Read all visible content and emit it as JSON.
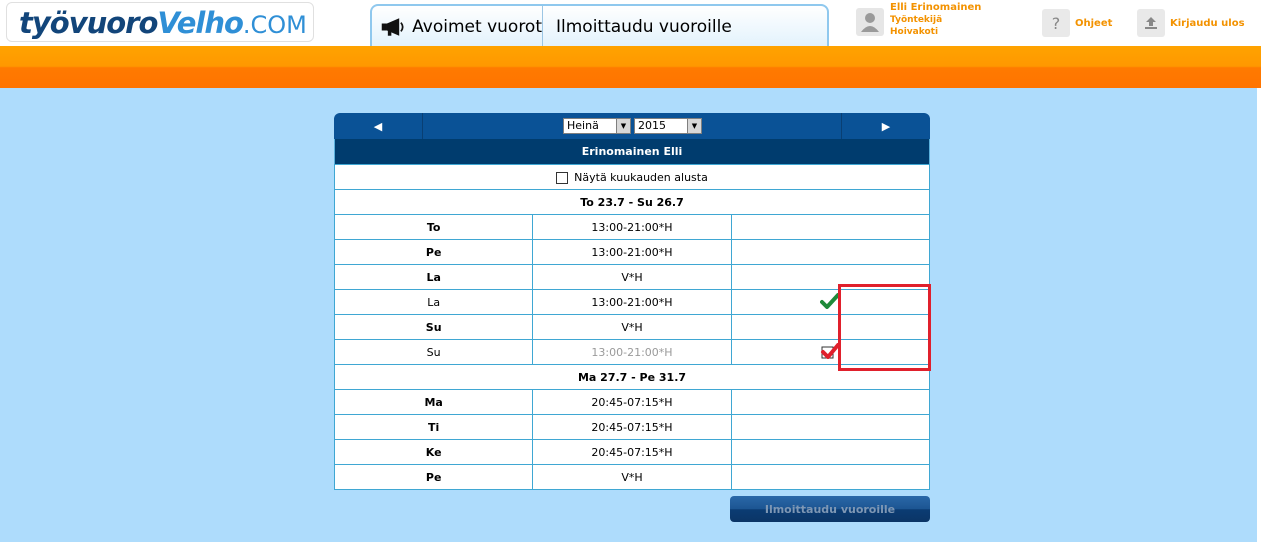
{
  "brand": {
    "part1": "työvuoro",
    "part2": "Velho",
    "part3": ".COM"
  },
  "nav": {
    "tabs": [
      {
        "label": "Avoimet vuorot",
        "icon": "megaphone-icon"
      },
      {
        "label": "Ilmoittaudu vuoroille"
      }
    ]
  },
  "user": {
    "name": "Elli Erinomainen",
    "role": "Työntekijä",
    "unit": "Hoivakoti"
  },
  "help": {
    "label": "Ohjeet",
    "icon": "question-icon"
  },
  "logout": {
    "label": "Kirjaudu ulos",
    "icon": "upload-icon"
  },
  "calendar": {
    "month": "Heinä",
    "year": "2015",
    "prev_icon": "arrow-left-icon",
    "next_icon": "arrow-right-icon",
    "employee": "Erinomainen Elli",
    "show_from_start_label": "Näytä kuukauden alusta",
    "weeks": [
      {
        "title": "To 23.7 - Su 26.7",
        "rows": [
          {
            "day": "To",
            "shift": "13:00-21:00*H",
            "bold": true,
            "mark": ""
          },
          {
            "day": "Pe",
            "shift": "13:00-21:00*H",
            "bold": true,
            "mark": ""
          },
          {
            "day": "La",
            "shift": "V*H",
            "bold": true,
            "mark": ""
          },
          {
            "day": "La",
            "shift": "13:00-21:00*H",
            "bold": false,
            "mark": "check-icon"
          },
          {
            "day": "Su",
            "shift": "V*H",
            "bold": true,
            "mark": ""
          },
          {
            "day": "Su",
            "shift": "13:00-21:00*H",
            "bold": false,
            "grey": true,
            "mark": "checkbox-checked-icon"
          }
        ]
      },
      {
        "title": "Ma 27.7 - Pe 31.7",
        "rows": [
          {
            "day": "Ma",
            "shift": "20:45-07:15*H",
            "bold": true,
            "mark": ""
          },
          {
            "day": "Ti",
            "shift": "20:45-07:15*H",
            "bold": true,
            "mark": ""
          },
          {
            "day": "Ke",
            "shift": "20:45-07:15*H",
            "bold": true,
            "mark": ""
          },
          {
            "day": "Pe",
            "shift": "V*H",
            "bold": true,
            "mark": ""
          }
        ]
      }
    ],
    "submit_label": "Ilmoittaudu vuoroille"
  },
  "colors": {
    "accent_orange": "#ff9800",
    "brand_blue": "#0a5296",
    "page_bg": "#aedcfc",
    "highlight": "#e0202c"
  }
}
